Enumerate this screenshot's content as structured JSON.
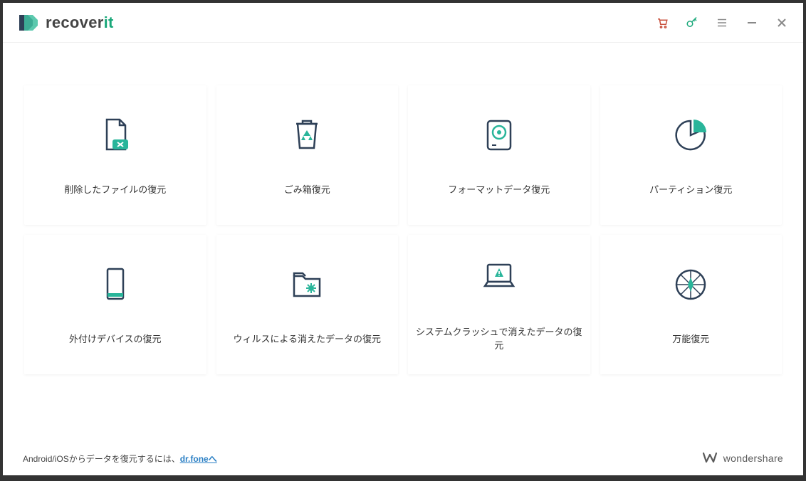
{
  "app": {
    "name_prefix": "recover",
    "name_accent": "it"
  },
  "cards": [
    {
      "label": "削除したファイルの復元"
    },
    {
      "label": "ごみ箱復元"
    },
    {
      "label": "フォーマットデータ復元"
    },
    {
      "label": "パーティション復元"
    },
    {
      "label": "外付けデバイスの復元"
    },
    {
      "label": "ウィルスによる消えたデータの復元"
    },
    {
      "label": "システムクラッシュで消えたデータの復元"
    },
    {
      "label": "万能復元"
    }
  ],
  "footer": {
    "prefix": "Android/iOSからデータを復元するには、",
    "link": "dr.foneへ",
    "brand": "wondershare"
  }
}
